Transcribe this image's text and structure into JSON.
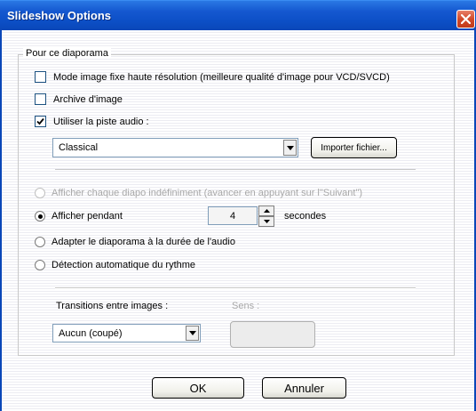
{
  "window": {
    "title": "Slideshow Options"
  },
  "group": {
    "label": "Pour ce diaporama"
  },
  "checkboxes": {
    "hires": {
      "label": "Mode image fixe haute résolution (meilleure qualité d'image pour VCD/SVCD)",
      "checked": false
    },
    "archive": {
      "label": "Archive d'image",
      "checked": false
    },
    "audio": {
      "label": "Utiliser la piste audio :",
      "checked": true
    }
  },
  "audio_track": {
    "value": "Classical",
    "import_label": "Importer fichier..."
  },
  "radios": {
    "indefinite": {
      "label": "Afficher chaque diapo indéfiniment (avancer en appuyant sur l\"Suivant\")",
      "enabled": false
    },
    "duration": {
      "label": "Afficher pendant",
      "selected": true
    },
    "fit_audio": {
      "label": "Adapter le diaporama à la durée de l'audio"
    },
    "beat": {
      "label": "Détection automatique du rythme"
    }
  },
  "duration": {
    "value": "4",
    "unit": "secondes"
  },
  "transitions": {
    "label": "Transitions entre images :",
    "value": "Aucun (coupé)",
    "direction_label": "Sens :"
  },
  "buttons": {
    "ok": "OK",
    "cancel": "Annuler"
  },
  "colors": {
    "titlebar": "#0a47b8",
    "close": "#d24a2a"
  }
}
